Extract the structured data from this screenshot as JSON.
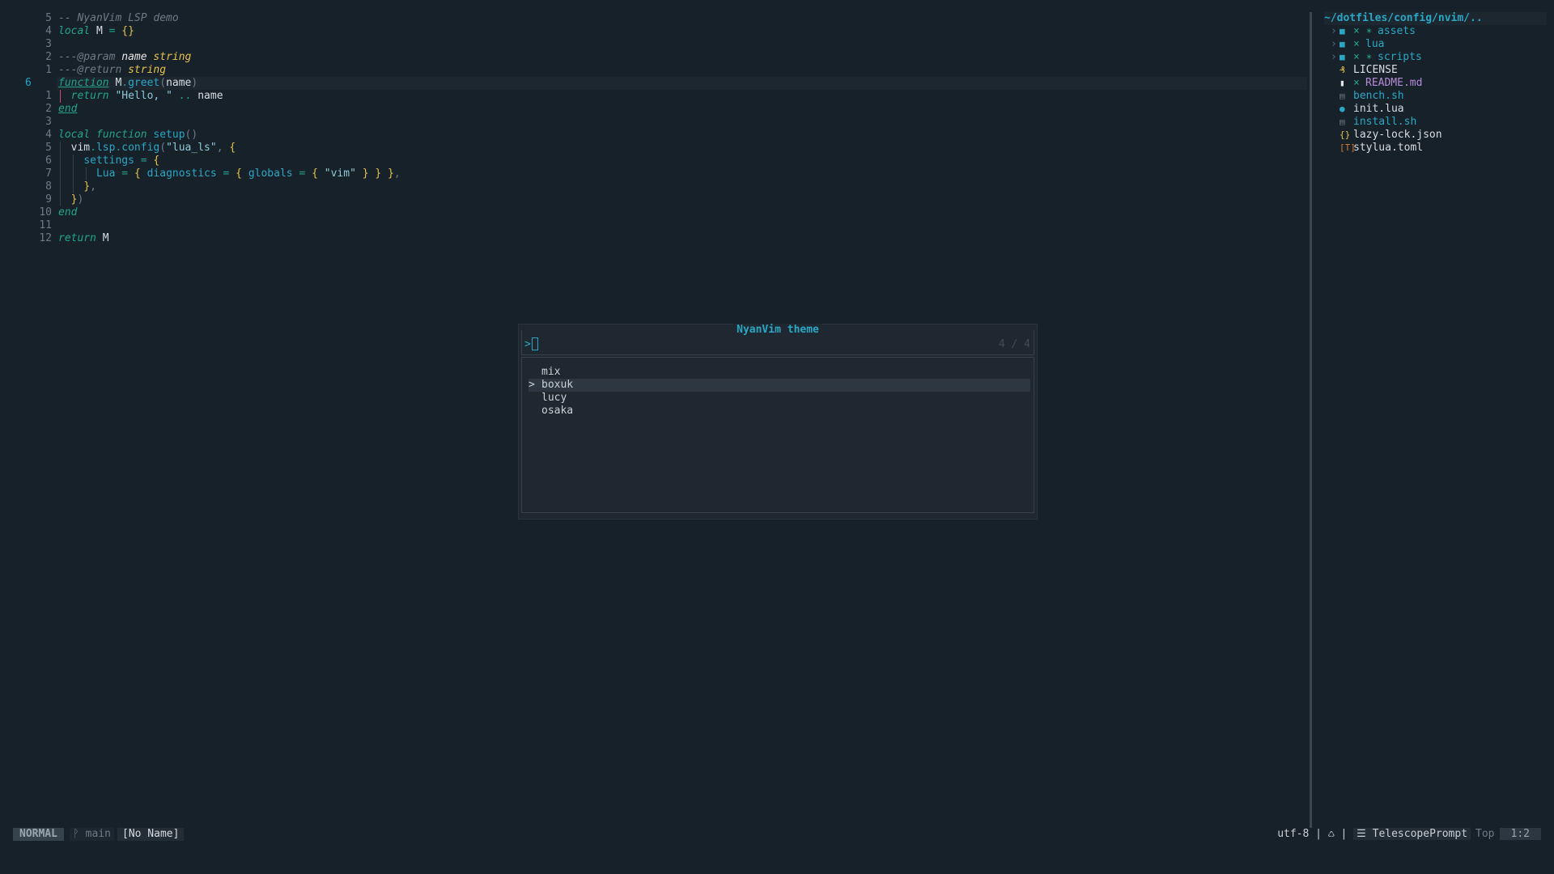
{
  "editor": {
    "lines": [
      {
        "num": "5",
        "tokens": [
          {
            "c": "c-comment",
            "t": "-- NyanVim LSP demo"
          }
        ]
      },
      {
        "num": "4",
        "tokens": [
          {
            "c": "c-kw",
            "t": "local"
          },
          {
            "c": "c-id",
            "t": " M "
          },
          {
            "c": "c-op",
            "t": "="
          },
          {
            "c": "c-id",
            "t": " "
          },
          {
            "c": "c-brace",
            "t": "{}"
          }
        ]
      },
      {
        "num": "3",
        "tokens": []
      },
      {
        "num": "2",
        "tokens": [
          {
            "c": "c-comment",
            "t": "---@param "
          },
          {
            "c": "c-param",
            "t": "name "
          },
          {
            "c": "c-type",
            "t": "string"
          }
        ]
      },
      {
        "num": "1",
        "tokens": [
          {
            "c": "c-comment",
            "t": "---@return "
          },
          {
            "c": "c-type",
            "t": "string"
          }
        ]
      },
      {
        "num": "6",
        "current": true,
        "tokens": [
          {
            "c": "c-kwu",
            "t": "function"
          },
          {
            "c": "c-id",
            "t": " M"
          },
          {
            "c": "c-op",
            "t": "."
          },
          {
            "c": "c-fn",
            "t": "greet"
          },
          {
            "c": "c-dim",
            "t": "("
          },
          {
            "c": "c-id",
            "t": "name"
          },
          {
            "c": "c-dim",
            "t": ")"
          }
        ]
      },
      {
        "num": "1",
        "tokens": [
          {
            "c": "c-id",
            "t": "  "
          },
          {
            "c": "c-kw",
            "t": "return"
          },
          {
            "c": "c-id",
            "t": " "
          },
          {
            "c": "c-str",
            "t": "\"Hello, \""
          },
          {
            "c": "c-id",
            "t": " "
          },
          {
            "c": "c-op",
            "t": ".."
          },
          {
            "c": "c-id",
            "t": " name"
          }
        ]
      },
      {
        "num": "2",
        "tokens": [
          {
            "c": "c-kwu",
            "t": "end"
          }
        ]
      },
      {
        "num": "3",
        "tokens": []
      },
      {
        "num": "4",
        "tokens": [
          {
            "c": "c-kw",
            "t": "local function"
          },
          {
            "c": "c-id",
            "t": " "
          },
          {
            "c": "c-fn",
            "t": "setup"
          },
          {
            "c": "c-dim",
            "t": "()"
          }
        ]
      },
      {
        "num": "5",
        "tokens": [
          {
            "c": "c-id",
            "t": "  vim"
          },
          {
            "c": "c-op",
            "t": "."
          },
          {
            "c": "c-fn",
            "t": "lsp"
          },
          {
            "c": "c-op",
            "t": "."
          },
          {
            "c": "c-fn",
            "t": "config"
          },
          {
            "c": "c-dim",
            "t": "("
          },
          {
            "c": "c-str",
            "t": "\"lua_ls\""
          },
          {
            "c": "c-dim",
            "t": ", "
          },
          {
            "c": "c-brace",
            "t": "{"
          }
        ]
      },
      {
        "num": "6",
        "tokens": [
          {
            "c": "c-id",
            "t": "    "
          },
          {
            "c": "c-fn",
            "t": "settings"
          },
          {
            "c": "c-id",
            "t": " "
          },
          {
            "c": "c-op",
            "t": "="
          },
          {
            "c": "c-id",
            "t": " "
          },
          {
            "c": "c-brace",
            "t": "{"
          }
        ]
      },
      {
        "num": "7",
        "tokens": [
          {
            "c": "c-id",
            "t": "      "
          },
          {
            "c": "c-fn",
            "t": "Lua"
          },
          {
            "c": "c-id",
            "t": " "
          },
          {
            "c": "c-op",
            "t": "="
          },
          {
            "c": "c-id",
            "t": " "
          },
          {
            "c": "c-brace",
            "t": "{"
          },
          {
            "c": "c-id",
            "t": " "
          },
          {
            "c": "c-fn",
            "t": "diagnostics"
          },
          {
            "c": "c-id",
            "t": " "
          },
          {
            "c": "c-op",
            "t": "="
          },
          {
            "c": "c-id",
            "t": " "
          },
          {
            "c": "c-brace",
            "t": "{"
          },
          {
            "c": "c-id",
            "t": " "
          },
          {
            "c": "c-fn",
            "t": "globals"
          },
          {
            "c": "c-id",
            "t": " "
          },
          {
            "c": "c-op",
            "t": "="
          },
          {
            "c": "c-id",
            "t": " "
          },
          {
            "c": "c-brace",
            "t": "{"
          },
          {
            "c": "c-id",
            "t": " "
          },
          {
            "c": "c-str",
            "t": "\"vim\""
          },
          {
            "c": "c-id",
            "t": " "
          },
          {
            "c": "c-brace",
            "t": "}"
          },
          {
            "c": "c-id",
            "t": " "
          },
          {
            "c": "c-brace",
            "t": "}"
          },
          {
            "c": "c-id",
            "t": " "
          },
          {
            "c": "c-brace",
            "t": "}"
          },
          {
            "c": "c-dim",
            "t": ","
          }
        ]
      },
      {
        "num": "8",
        "tokens": [
          {
            "c": "c-id",
            "t": "    "
          },
          {
            "c": "c-brace",
            "t": "}"
          },
          {
            "c": "c-dim",
            "t": ","
          }
        ]
      },
      {
        "num": "9",
        "tokens": [
          {
            "c": "c-id",
            "t": "  "
          },
          {
            "c": "c-brace",
            "t": "}"
          },
          {
            "c": "c-dim",
            "t": ")"
          }
        ]
      },
      {
        "num": "10",
        "tokens": [
          {
            "c": "c-kw",
            "t": "end"
          }
        ]
      },
      {
        "num": "11",
        "tokens": []
      },
      {
        "num": "12",
        "tokens": [
          {
            "c": "c-kw",
            "t": "return"
          },
          {
            "c": "c-id",
            "t": " M"
          }
        ]
      }
    ]
  },
  "tree": {
    "root": "~/dotfiles/config/nvim/..",
    "items": [
      {
        "arrow": "›",
        "icon": "folder-icon",
        "glyph": "■",
        "iconColor": "#2aa7c4",
        "mark": "× ∗",
        "name": "assets",
        "color": "#2aa7c4"
      },
      {
        "arrow": "›",
        "icon": "folder-icon",
        "glyph": "■",
        "iconColor": "#2aa7c4",
        "mark": "×",
        "name": "lua",
        "color": "#2aa7c4"
      },
      {
        "arrow": "›",
        "icon": "folder-icon",
        "glyph": "■",
        "iconColor": "#2aa7c4",
        "mark": "× ∗",
        "name": "scripts",
        "color": "#2aa7c4"
      },
      {
        "arrow": "",
        "icon": "license-icon",
        "glyph": "₰",
        "iconColor": "#e7c14d",
        "mark": "",
        "name": "LICENSE",
        "color": "#d7dde2"
      },
      {
        "arrow": "",
        "icon": "markdown-icon",
        "glyph": "▮",
        "iconColor": "#e6e6e6",
        "mark": "×",
        "name": "README.md",
        "color": "#b58cd8"
      },
      {
        "arrow": "",
        "icon": "shell-icon",
        "glyph": "▤",
        "iconColor": "#5b6a75",
        "mark": "",
        "name": "bench.sh",
        "color": "#2aa7c4"
      },
      {
        "arrow": "",
        "icon": "lua-icon",
        "glyph": "●",
        "iconColor": "#2aa7c4",
        "mark": "",
        "name": "init.lua",
        "color": "#d7dde2"
      },
      {
        "arrow": "",
        "icon": "shell-icon",
        "glyph": "▤",
        "iconColor": "#5b6a75",
        "mark": "",
        "name": "install.sh",
        "color": "#2aa7c4"
      },
      {
        "arrow": "",
        "icon": "json-icon",
        "glyph": "{}",
        "iconColor": "#e7c14d",
        "mark": "",
        "name": "lazy-lock.json",
        "color": "#d7dde2"
      },
      {
        "arrow": "",
        "icon": "toml-icon",
        "glyph": "[T]",
        "iconColor": "#d9772d",
        "mark": "",
        "name": "stylua.toml",
        "color": "#d7dde2"
      }
    ]
  },
  "telescope": {
    "title": "NyanVim theme",
    "prompt_prefix": ">",
    "count": "4 / 4",
    "selected_marker": ">",
    "results": [
      {
        "label": "mix",
        "selected": false
      },
      {
        "label": "boxuk",
        "selected": true
      },
      {
        "label": "lucy",
        "selected": false
      },
      {
        "label": "osaka",
        "selected": false
      }
    ]
  },
  "statusline": {
    "mode": "NORMAL",
    "branch_icon": "ᚹ",
    "branch": "main",
    "filename": "[No Name]",
    "encoding": "utf-8",
    "sep": "|",
    "os_icon": "♺",
    "filetype_icon": "☰",
    "filetype": "TelescopePrompt",
    "position_label": "Top",
    "cursor": "1:2"
  },
  "colors": {
    "background": "#17212a",
    "accent": "#2aa7c4",
    "keyword": "#22a38c",
    "brace": "#e7c14d"
  }
}
